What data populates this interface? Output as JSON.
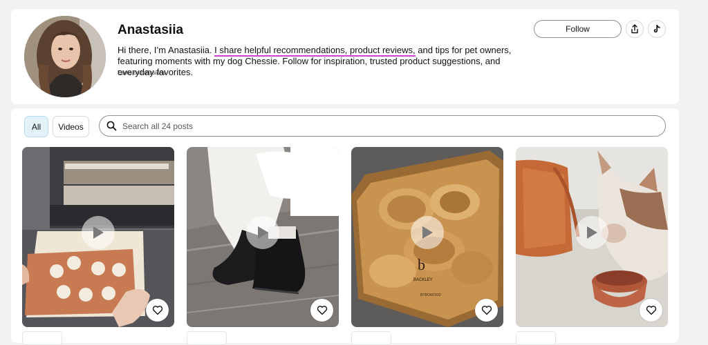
{
  "profile": {
    "name": "Anastasiia",
    "bio_before": "Hi there, I’m Anastasiia. ",
    "bio_highlight": "I share helpful recommendations, product reviews,",
    "bio_after": " and tips for pet owners, featuring moments with my dog Chessie. Follow for inspiration, trusted product suggestions, and everyday favorites.",
    "earns": "Earns commissions",
    "follow_label": "Follow",
    "highlight_color": "#d63fd1"
  },
  "filters": {
    "all_label": "All",
    "videos_label": "Videos"
  },
  "search": {
    "placeholder": "Search all 24 posts"
  },
  "posts": [
    {
      "icon": "play-icon",
      "subject": "air fryer oven with pizza"
    },
    {
      "icon": "play-icon",
      "subject": "black leather shoes"
    },
    {
      "icon": "play-icon",
      "subject": "wooden cutting board"
    },
    {
      "icon": "play-icon",
      "subject": "dog with bowl"
    }
  ],
  "overlay_text": {
    "board_logo": "b",
    "board_brand": "BACKLEY",
    "board_maker": "BYBOWOOD"
  }
}
